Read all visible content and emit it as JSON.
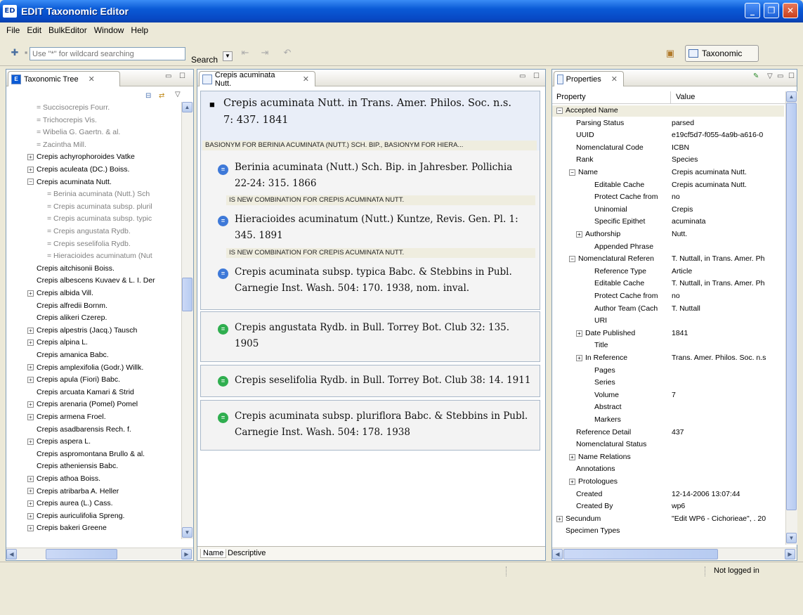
{
  "window": {
    "title": "EDIT Taxonomic Editor",
    "logo": "ED"
  },
  "menu": [
    "File",
    "Edit",
    "BulkEditor",
    "Window",
    "Help"
  ],
  "toolbar": {
    "search_placeholder": "Use \"*\" for wildcard searching",
    "search_label": "Search",
    "perspective": "Taxonomic"
  },
  "tree": {
    "tab": "Taxonomic Tree",
    "items": [
      {
        "t": "= Succisocrepis Fourr.",
        "lvl": 1,
        "syn": true,
        "pm": ""
      },
      {
        "t": "= Trichocrepis Vis.",
        "lvl": 1,
        "syn": true,
        "pm": ""
      },
      {
        "t": "= Wibelia G. Gaertn. & al.",
        "lvl": 1,
        "syn": true,
        "pm": ""
      },
      {
        "t": "= Zacintha Mill.",
        "lvl": 1,
        "syn": true,
        "pm": ""
      },
      {
        "t": "Crepis achyrophoroides Vatke",
        "lvl": 0,
        "syn": false,
        "pm": "+"
      },
      {
        "t": "Crepis aculeata (DC.) Boiss.",
        "lvl": 0,
        "syn": false,
        "pm": "+"
      },
      {
        "t": "Crepis acuminata Nutt.",
        "lvl": 0,
        "syn": false,
        "pm": "−"
      },
      {
        "t": "= Berinia acuminata (Nutt.) Sch",
        "lvl": 2,
        "syn": true,
        "pm": ""
      },
      {
        "t": "= Crepis acuminata subsp. pluril",
        "lvl": 2,
        "syn": true,
        "pm": ""
      },
      {
        "t": "= Crepis acuminata subsp. typic",
        "lvl": 2,
        "syn": true,
        "pm": ""
      },
      {
        "t": "= Crepis angustata Rydb.",
        "lvl": 2,
        "syn": true,
        "pm": ""
      },
      {
        "t": "= Crepis seselifolia Rydb.",
        "lvl": 2,
        "syn": true,
        "pm": ""
      },
      {
        "t": "= Hieracioides acuminatum (Nut",
        "lvl": 2,
        "syn": true,
        "pm": ""
      },
      {
        "t": "Crepis aitchisonii Boiss.",
        "lvl": 1,
        "syn": false,
        "pm": ""
      },
      {
        "t": "Crepis albescens Kuvaev & L. I. Der",
        "lvl": 1,
        "syn": false,
        "pm": ""
      },
      {
        "t": "Crepis albida Vill.",
        "lvl": 0,
        "syn": false,
        "pm": "+"
      },
      {
        "t": "Crepis alfredii Bornm.",
        "lvl": 1,
        "syn": false,
        "pm": ""
      },
      {
        "t": "Crepis alikeri Czerep.",
        "lvl": 1,
        "syn": false,
        "pm": ""
      },
      {
        "t": "Crepis alpestris (Jacq.) Tausch",
        "lvl": 0,
        "syn": false,
        "pm": "+"
      },
      {
        "t": "Crepis alpina L.",
        "lvl": 0,
        "syn": false,
        "pm": "+"
      },
      {
        "t": "Crepis amanica Babc.",
        "lvl": 1,
        "syn": false,
        "pm": ""
      },
      {
        "t": "Crepis amplexifolia (Godr.) Willk.",
        "lvl": 0,
        "syn": false,
        "pm": "+"
      },
      {
        "t": "Crepis apula (Fiori) Babc.",
        "lvl": 0,
        "syn": false,
        "pm": "+"
      },
      {
        "t": "Crepis arcuata Kamari & Strid",
        "lvl": 1,
        "syn": false,
        "pm": ""
      },
      {
        "t": "Crepis arenaria (Pomel) Pomel",
        "lvl": 0,
        "syn": false,
        "pm": "+"
      },
      {
        "t": "Crepis armena Froel.",
        "lvl": 0,
        "syn": false,
        "pm": "+"
      },
      {
        "t": "Crepis asadbarensis Rech. f.",
        "lvl": 1,
        "syn": false,
        "pm": ""
      },
      {
        "t": "Crepis aspera L.",
        "lvl": 0,
        "syn": false,
        "pm": "+"
      },
      {
        "t": "Crepis aspromontana Brullo & al.",
        "lvl": 1,
        "syn": false,
        "pm": ""
      },
      {
        "t": "Crepis atheniensis Babc.",
        "lvl": 1,
        "syn": false,
        "pm": ""
      },
      {
        "t": "Crepis athoa Boiss.",
        "lvl": 0,
        "syn": false,
        "pm": "+"
      },
      {
        "t": "Crepis atribarba A. Heller",
        "lvl": 0,
        "syn": false,
        "pm": "+"
      },
      {
        "t": "Crepis aurea (L.) Cass.",
        "lvl": 0,
        "syn": false,
        "pm": "+"
      },
      {
        "t": "Crepis auriculifolia Spreng.",
        "lvl": 0,
        "syn": false,
        "pm": "+"
      },
      {
        "t": "Crepis bakeri Greene",
        "lvl": 0,
        "syn": false,
        "pm": "+"
      }
    ]
  },
  "editor": {
    "tab": "Crepis acuminata Nutt.",
    "accepted_line1": "Crepis acuminata Nutt. in Trans. Amer. Philos. Soc. n.s.",
    "accepted_line2": "7: 437. 1841",
    "accepted_rel": "BASIONYM FOR BERINIA ACUMINATA (NUTT.) SCH. BIP., BASIONYM FOR HIERA...",
    "h1_line1": "Berinia acuminata (Nutt.) Sch. Bip. in Jahresber. Pollichia",
    "h1_line2": "22-24: 315. 1866",
    "h1_rel": "IS NEW COMBINATION FOR CREPIS ACUMINATA NUTT.",
    "h2_line1": "Hieracioides acuminatum (Nutt.) Kuntze, Revis. Gen. Pl. 1:",
    "h2_line2": "345. 1891",
    "h2_rel": "IS NEW COMBINATION FOR CREPIS ACUMINATA NUTT.",
    "h3_line1": "Crepis acuminata subsp. typica Babc. & Stebbins in Publ.",
    "h3_line2": "Carnegie Inst. Wash. 504: 170. 1938, nom. inval.",
    "g1_line1": "Crepis angustata Rydb. in Bull. Torrey Bot. Club 32: 135.",
    "g1_line2": "1905",
    "g2_line1": "Crepis seselifolia Rydb. in Bull. Torrey Bot. Club 38: 14. 1911",
    "g3_line1": "Crepis acuminata subsp. pluriflora Babc. & Stebbins in Publ.",
    "g3_line2": "Carnegie Inst. Wash. 504: 178. 1938",
    "bottom_tabs": [
      "Name",
      "Descriptive"
    ]
  },
  "properties": {
    "tab": "Properties",
    "col_property": "Property",
    "col_value": "Value",
    "rows": [
      {
        "k": "Accepted Name",
        "v": "",
        "lvl": 0,
        "pm": "−"
      },
      {
        "k": "Parsing Status",
        "v": "parsed",
        "lvl": 2,
        "pm": ""
      },
      {
        "k": "UUID",
        "v": "e19cf5d7-f055-4a9b-a616-0",
        "lvl": 2,
        "pm": ""
      },
      {
        "k": "Nomenclatural Code",
        "v": "ICBN",
        "lvl": 2,
        "pm": ""
      },
      {
        "k": "Rank",
        "v": "Species",
        "lvl": 2,
        "pm": ""
      },
      {
        "k": "Name",
        "v": "Crepis acuminata Nutt.",
        "lvl": 1,
        "pm": "−"
      },
      {
        "k": "Editable Cache",
        "v": "Crepis acuminata Nutt.",
        "lvl": 3,
        "pm": ""
      },
      {
        "k": "Protect Cache from",
        "v": "no",
        "lvl": 3,
        "pm": ""
      },
      {
        "k": "Uninomial",
        "v": "Crepis",
        "lvl": 3,
        "pm": ""
      },
      {
        "k": "Specific Epithet",
        "v": "acuminata",
        "lvl": 3,
        "pm": ""
      },
      {
        "k": "Authorship",
        "v": "Nutt.",
        "lvl": 2,
        "pm": "+"
      },
      {
        "k": "Appended Phrase",
        "v": "",
        "lvl": 3,
        "pm": ""
      },
      {
        "k": "Nomenclatural Referen",
        "v": "T. Nuttall, in Trans. Amer. Ph",
        "lvl": 1,
        "pm": "−"
      },
      {
        "k": "Reference Type",
        "v": "Article",
        "lvl": 3,
        "pm": ""
      },
      {
        "k": "Editable Cache",
        "v": "T. Nuttall, in Trans. Amer. Ph",
        "lvl": 3,
        "pm": ""
      },
      {
        "k": "Protect Cache from",
        "v": "no",
        "lvl": 3,
        "pm": ""
      },
      {
        "k": "Author Team (Cach",
        "v": "T. Nuttall",
        "lvl": 3,
        "pm": ""
      },
      {
        "k": "URI",
        "v": "",
        "lvl": 3,
        "pm": ""
      },
      {
        "k": "Date Published",
        "v": "1841",
        "lvl": 2,
        "pm": "+"
      },
      {
        "k": "Title",
        "v": "",
        "lvl": 3,
        "pm": ""
      },
      {
        "k": "In Reference",
        "v": "Trans. Amer. Philos. Soc. n.s",
        "lvl": 2,
        "pm": "+"
      },
      {
        "k": "Pages",
        "v": "",
        "lvl": 3,
        "pm": ""
      },
      {
        "k": "Series",
        "v": "",
        "lvl": 3,
        "pm": ""
      },
      {
        "k": "Volume",
        "v": "7",
        "lvl": 3,
        "pm": ""
      },
      {
        "k": "Abstract",
        "v": "",
        "lvl": 3,
        "pm": ""
      },
      {
        "k": "Markers",
        "v": "",
        "lvl": 3,
        "pm": ""
      },
      {
        "k": "Reference Detail",
        "v": "437",
        "lvl": 2,
        "pm": ""
      },
      {
        "k": "Nomenclatural Status",
        "v": "",
        "lvl": 2,
        "pm": ""
      },
      {
        "k": "Name Relations",
        "v": "",
        "lvl": 1,
        "pm": "+"
      },
      {
        "k": "Annotations",
        "v": "",
        "lvl": 2,
        "pm": ""
      },
      {
        "k": "Protologues",
        "v": "",
        "lvl": 1,
        "pm": "+"
      },
      {
        "k": "Created",
        "v": "12-14-2006 13:07:44",
        "lvl": 2,
        "pm": ""
      },
      {
        "k": "Created By",
        "v": "wp6",
        "lvl": 2,
        "pm": ""
      },
      {
        "k": "Secundum",
        "v": "\"Edit WP6 - Cichorieae\", . 20",
        "lvl": 0,
        "pm": "+"
      },
      {
        "k": "Specimen Types",
        "v": "",
        "lvl": 0,
        "pm": ""
      }
    ]
  },
  "status": {
    "login": "Not logged in"
  }
}
